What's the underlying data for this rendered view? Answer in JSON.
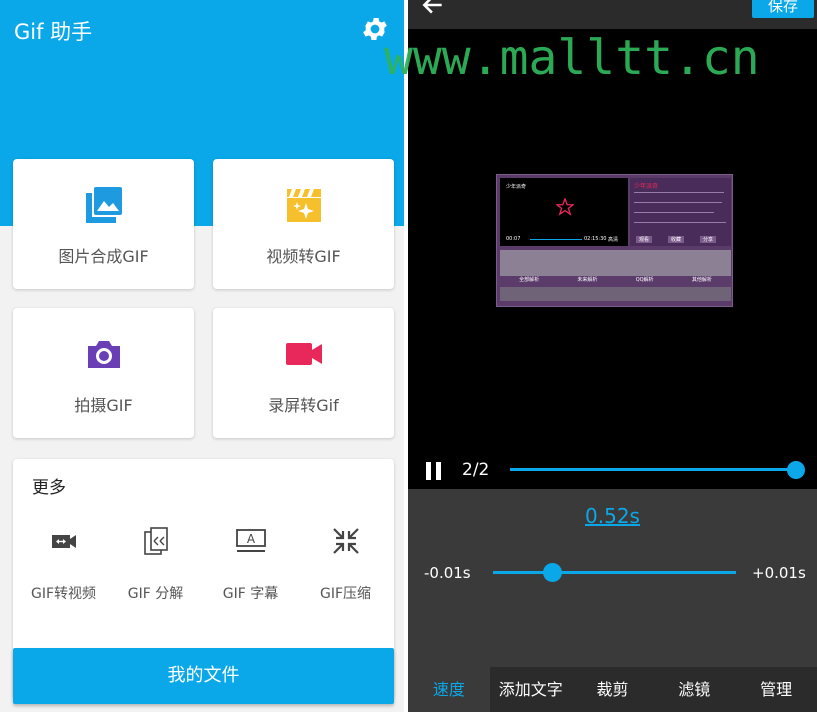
{
  "left": {
    "app_title": "Gif 助手",
    "cards": [
      {
        "label": "图片合成GIF",
        "icon": "image-stack-icon"
      },
      {
        "label": "视频转GIF",
        "icon": "clapperboard-icon"
      },
      {
        "label": "拍摄GIF",
        "icon": "camera-icon"
      },
      {
        "label": "录屏转Gif",
        "icon": "video-camera-icon"
      }
    ],
    "more": {
      "title": "更多",
      "tools": [
        {
          "label": "GIF转视频",
          "icon": "gif-to-video-icon"
        },
        {
          "label": "GIF 分解",
          "icon": "split-icon"
        },
        {
          "label": "GIF 字幕",
          "icon": "subtitle-icon"
        },
        {
          "label": "GIF压缩",
          "icon": "compress-icon"
        }
      ]
    },
    "my_files_label": "我的文件",
    "colors": {
      "accent": "#0aa8e8",
      "camera": "#6a3fb5",
      "clapper": "#f6c02c",
      "record": "#e8285a"
    }
  },
  "right": {
    "save_label": "保存",
    "watermark": "www.malltt.cn",
    "frame_counter": "2/2",
    "seek_progress": 1.0,
    "delay_value": "0.52s",
    "minus_label": "-0.01s",
    "plus_label": "+0.01s",
    "tabs": [
      "速度",
      "添加文字",
      "裁剪",
      "滤镜",
      "管理"
    ],
    "active_tab": 0,
    "preview": {
      "player_title": "少年派奇",
      "time_left": "00:07",
      "time_right": "02:15:30",
      "quality": "高清",
      "info_title": "少年派奇",
      "buttons": [
        "观看",
        "收藏",
        "分享"
      ],
      "tabs": [
        "全部解析",
        "未来解析",
        "QQ解析",
        "其他解析"
      ]
    }
  }
}
